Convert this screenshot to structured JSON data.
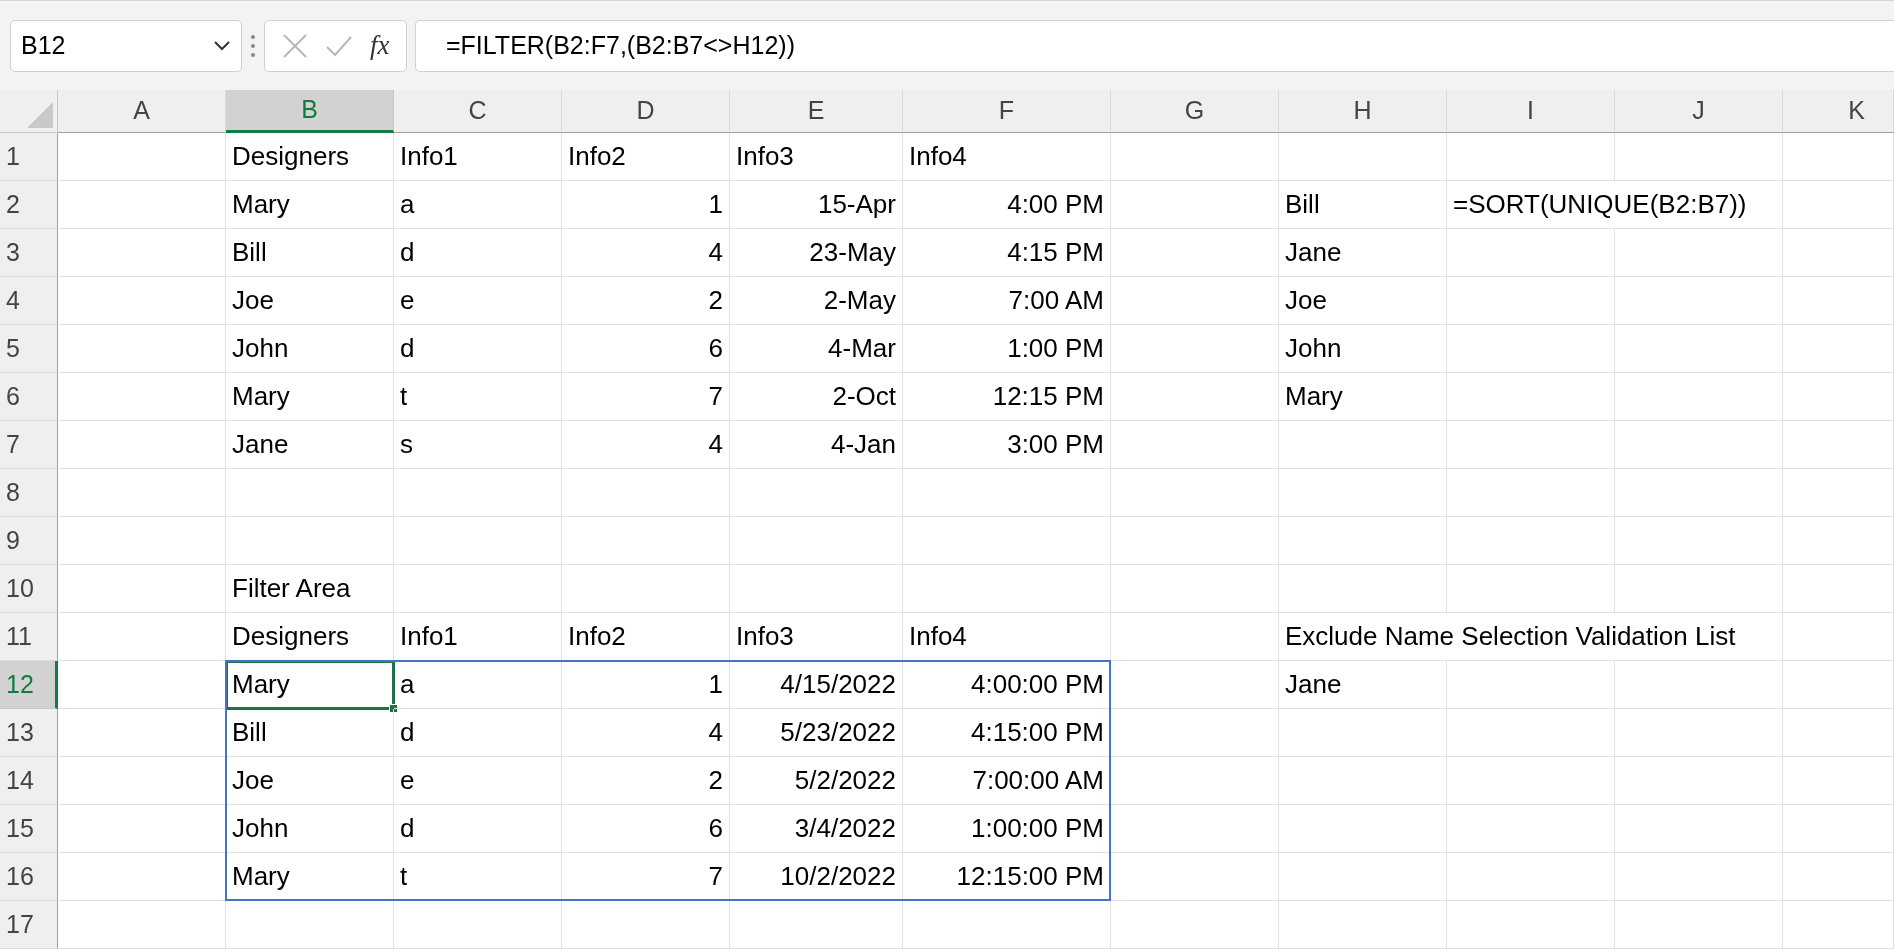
{
  "name_box": {
    "value": "B12"
  },
  "formula_bar": {
    "function_label": "fx",
    "value": "=FILTER(B2:F7,(B2:B7<>H12))"
  },
  "spill_border": true,
  "columns": [
    {
      "label": "A",
      "selected": false
    },
    {
      "label": "B",
      "selected": true
    },
    {
      "label": "C",
      "selected": false
    },
    {
      "label": "D",
      "selected": false
    },
    {
      "label": "E",
      "selected": false
    },
    {
      "label": "F",
      "selected": false
    },
    {
      "label": "G",
      "selected": false
    },
    {
      "label": "H",
      "selected": false
    },
    {
      "label": "I",
      "selected": false
    },
    {
      "label": "J",
      "selected": false
    },
    {
      "label": "K",
      "selected": false
    }
  ],
  "rows": [
    {
      "label": "1",
      "selected": false,
      "cells": {
        "B": {
          "text": "Designers",
          "kind": "text",
          "selected": false
        },
        "C": {
          "text": "Info1",
          "kind": "text",
          "selected": false
        },
        "D": {
          "text": "Info2",
          "kind": "text",
          "selected": false
        },
        "E": {
          "text": "Info3",
          "kind": "text",
          "selected": false
        },
        "F": {
          "text": "Info4",
          "kind": "text",
          "selected": false
        }
      }
    },
    {
      "label": "2",
      "selected": false,
      "cells": {
        "B": {
          "text": "Mary",
          "kind": "text",
          "selected": false
        },
        "C": {
          "text": "a",
          "kind": "text",
          "selected": false
        },
        "D": {
          "text": "1",
          "kind": "number",
          "selected": false
        },
        "E": {
          "text": "15-Apr",
          "kind": "number",
          "selected": false
        },
        "F": {
          "text": "4:00 PM",
          "kind": "number",
          "selected": false
        },
        "H": {
          "text": "Bill",
          "kind": "text",
          "selected": false
        },
        "I": {
          "text": "=SORT(UNIQUE(B2:B7))",
          "kind": "text",
          "selected": false
        }
      }
    },
    {
      "label": "3",
      "selected": false,
      "cells": {
        "B": {
          "text": "Bill",
          "kind": "text",
          "selected": false
        },
        "C": {
          "text": "d",
          "kind": "text",
          "selected": false
        },
        "D": {
          "text": "4",
          "kind": "number",
          "selected": false
        },
        "E": {
          "text": "23-May",
          "kind": "number",
          "selected": false
        },
        "F": {
          "text": "4:15 PM",
          "kind": "number",
          "selected": false
        },
        "H": {
          "text": "Jane",
          "kind": "text",
          "selected": false
        }
      }
    },
    {
      "label": "4",
      "selected": false,
      "cells": {
        "B": {
          "text": "Joe",
          "kind": "text",
          "selected": false
        },
        "C": {
          "text": "e",
          "kind": "text",
          "selected": false
        },
        "D": {
          "text": "2",
          "kind": "number",
          "selected": false
        },
        "E": {
          "text": "2-May",
          "kind": "number",
          "selected": false
        },
        "F": {
          "text": "7:00 AM",
          "kind": "number",
          "selected": false
        },
        "H": {
          "text": "Joe",
          "kind": "text",
          "selected": false
        }
      }
    },
    {
      "label": "5",
      "selected": false,
      "cells": {
        "B": {
          "text": "John",
          "kind": "text",
          "selected": false
        },
        "C": {
          "text": "d",
          "kind": "text",
          "selected": false
        },
        "D": {
          "text": "6",
          "kind": "number",
          "selected": false
        },
        "E": {
          "text": "4-Mar",
          "kind": "number",
          "selected": false
        },
        "F": {
          "text": "1:00 PM",
          "kind": "number",
          "selected": false
        },
        "H": {
          "text": "John",
          "kind": "text",
          "selected": false
        }
      }
    },
    {
      "label": "6",
      "selected": false,
      "cells": {
        "B": {
          "text": "Mary",
          "kind": "text",
          "selected": false
        },
        "C": {
          "text": "t",
          "kind": "text",
          "selected": false
        },
        "D": {
          "text": "7",
          "kind": "number",
          "selected": false
        },
        "E": {
          "text": "2-Oct",
          "kind": "number",
          "selected": false
        },
        "F": {
          "text": "12:15 PM",
          "kind": "number",
          "selected": false
        },
        "H": {
          "text": "Mary",
          "kind": "text",
          "selected": false
        }
      }
    },
    {
      "label": "7",
      "selected": false,
      "cells": {
        "B": {
          "text": "Jane",
          "kind": "text",
          "selected": false
        },
        "C": {
          "text": "s",
          "kind": "text",
          "selected": false
        },
        "D": {
          "text": "4",
          "kind": "number",
          "selected": false
        },
        "E": {
          "text": "4-Jan",
          "kind": "number",
          "selected": false
        },
        "F": {
          "text": "3:00 PM",
          "kind": "number",
          "selected": false
        }
      }
    },
    {
      "label": "8",
      "selected": false
    },
    {
      "label": "9",
      "selected": false
    },
    {
      "label": "10",
      "selected": false,
      "cells": {
        "B": {
          "text": "Filter Area",
          "kind": "text",
          "selected": false
        }
      }
    },
    {
      "label": "11",
      "selected": false,
      "cells": {
        "B": {
          "text": "Designers",
          "kind": "text",
          "selected": false
        },
        "C": {
          "text": "Info1",
          "kind": "text",
          "selected": false
        },
        "D": {
          "text": "Info2",
          "kind": "text",
          "selected": false
        },
        "E": {
          "text": "Info3",
          "kind": "text",
          "selected": false
        },
        "F": {
          "text": "Info4",
          "kind": "text",
          "selected": false
        },
        "H": {
          "text": "Exclude Name Selection Validation List",
          "kind": "text",
          "selected": false
        }
      }
    },
    {
      "label": "12",
      "selected": true,
      "cells": {
        "B": {
          "text": "Mary",
          "kind": "text",
          "selected": true
        },
        "C": {
          "text": "a",
          "kind": "text",
          "selected": false
        },
        "D": {
          "text": "1",
          "kind": "number",
          "selected": false
        },
        "E": {
          "text": "4/15/2022",
          "kind": "number",
          "selected": false
        },
        "F": {
          "text": "4:00:00 PM",
          "kind": "number",
          "selected": false
        },
        "H": {
          "text": "Jane",
          "kind": "text",
          "selected": false
        }
      }
    },
    {
      "label": "13",
      "selected": false,
      "cells": {
        "B": {
          "text": "Bill",
          "kind": "text",
          "selected": false
        },
        "C": {
          "text": "d",
          "kind": "text",
          "selected": false
        },
        "D": {
          "text": "4",
          "kind": "number",
          "selected": false
        },
        "E": {
          "text": "5/23/2022",
          "kind": "number",
          "selected": false
        },
        "F": {
          "text": "4:15:00 PM",
          "kind": "number",
          "selected": false
        }
      }
    },
    {
      "label": "14",
      "selected": false,
      "cells": {
        "B": {
          "text": "Joe",
          "kind": "text",
          "selected": false
        },
        "C": {
          "text": "e",
          "kind": "text",
          "selected": false
        },
        "D": {
          "text": "2",
          "kind": "number",
          "selected": false
        },
        "E": {
          "text": "5/2/2022",
          "kind": "number",
          "selected": false
        },
        "F": {
          "text": "7:00:00 AM",
          "kind": "number",
          "selected": false
        }
      }
    },
    {
      "label": "15",
      "selected": false,
      "cells": {
        "B": {
          "text": "John",
          "kind": "text",
          "selected": false
        },
        "C": {
          "text": "d",
          "kind": "text",
          "selected": false
        },
        "D": {
          "text": "6",
          "kind": "number",
          "selected": false
        },
        "E": {
          "text": "3/4/2022",
          "kind": "number",
          "selected": false
        },
        "F": {
          "text": "1:00:00 PM",
          "kind": "number",
          "selected": false
        }
      }
    },
    {
      "label": "16",
      "selected": false,
      "cells": {
        "B": {
          "text": "Mary",
          "kind": "text",
          "selected": false
        },
        "C": {
          "text": "t",
          "kind": "text",
          "selected": false
        },
        "D": {
          "text": "7",
          "kind": "number",
          "selected": false
        },
        "E": {
          "text": "10/2/2022",
          "kind": "number",
          "selected": false
        },
        "F": {
          "text": "12:15:00 PM",
          "kind": "number",
          "selected": false
        }
      }
    },
    {
      "label": "17",
      "selected": false
    }
  ]
}
